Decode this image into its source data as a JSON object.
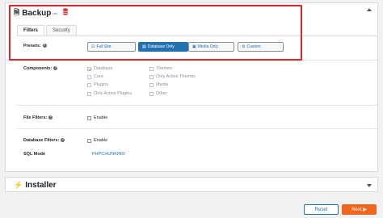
{
  "backup": {
    "title": "Backup",
    "badge": "def",
    "tabs": [
      {
        "label": "Filters",
        "active": true
      },
      {
        "label": "Security",
        "active": false
      }
    ],
    "presets_label": "Presets:",
    "presets": [
      {
        "label": "Full Site",
        "icon": "checkbox-icon",
        "active": false
      },
      {
        "label": "Database Only",
        "icon": "database-icon",
        "active": true
      },
      {
        "label": "Media Only",
        "icon": "image-icon",
        "active": false
      },
      {
        "label": "Custom",
        "icon": "gear-icon",
        "active": false
      }
    ],
    "components_label": "Components:",
    "components_left": [
      {
        "label": "Database",
        "checked": true
      },
      {
        "label": "Core",
        "checked": false
      },
      {
        "label": "Plugins",
        "checked": false
      },
      {
        "label": "Only Active Plugins",
        "checked": false
      }
    ],
    "components_right": [
      {
        "label": "Themes",
        "checked": false
      },
      {
        "label": "Only Active Themes",
        "checked": false
      },
      {
        "label": "Media",
        "checked": false
      },
      {
        "label": "Other",
        "checked": false
      }
    ],
    "file_filters_label": "File Filters:",
    "file_filters_enable": "Enable",
    "database_filters_label": "Database Filters:",
    "database_filters_enable": "Enable",
    "sql_mode_label": "SQL Mode",
    "sql_mode_value": "PHPCHUNKING"
  },
  "installer": {
    "title": "Installer"
  },
  "footer": {
    "reset_label": "Reset",
    "next_label": "Next ▶"
  },
  "colors": {
    "accent": "#2271b1",
    "highlight_border": "#e0262c",
    "next_button": "#f0661e",
    "database_icon": "#d63638"
  }
}
